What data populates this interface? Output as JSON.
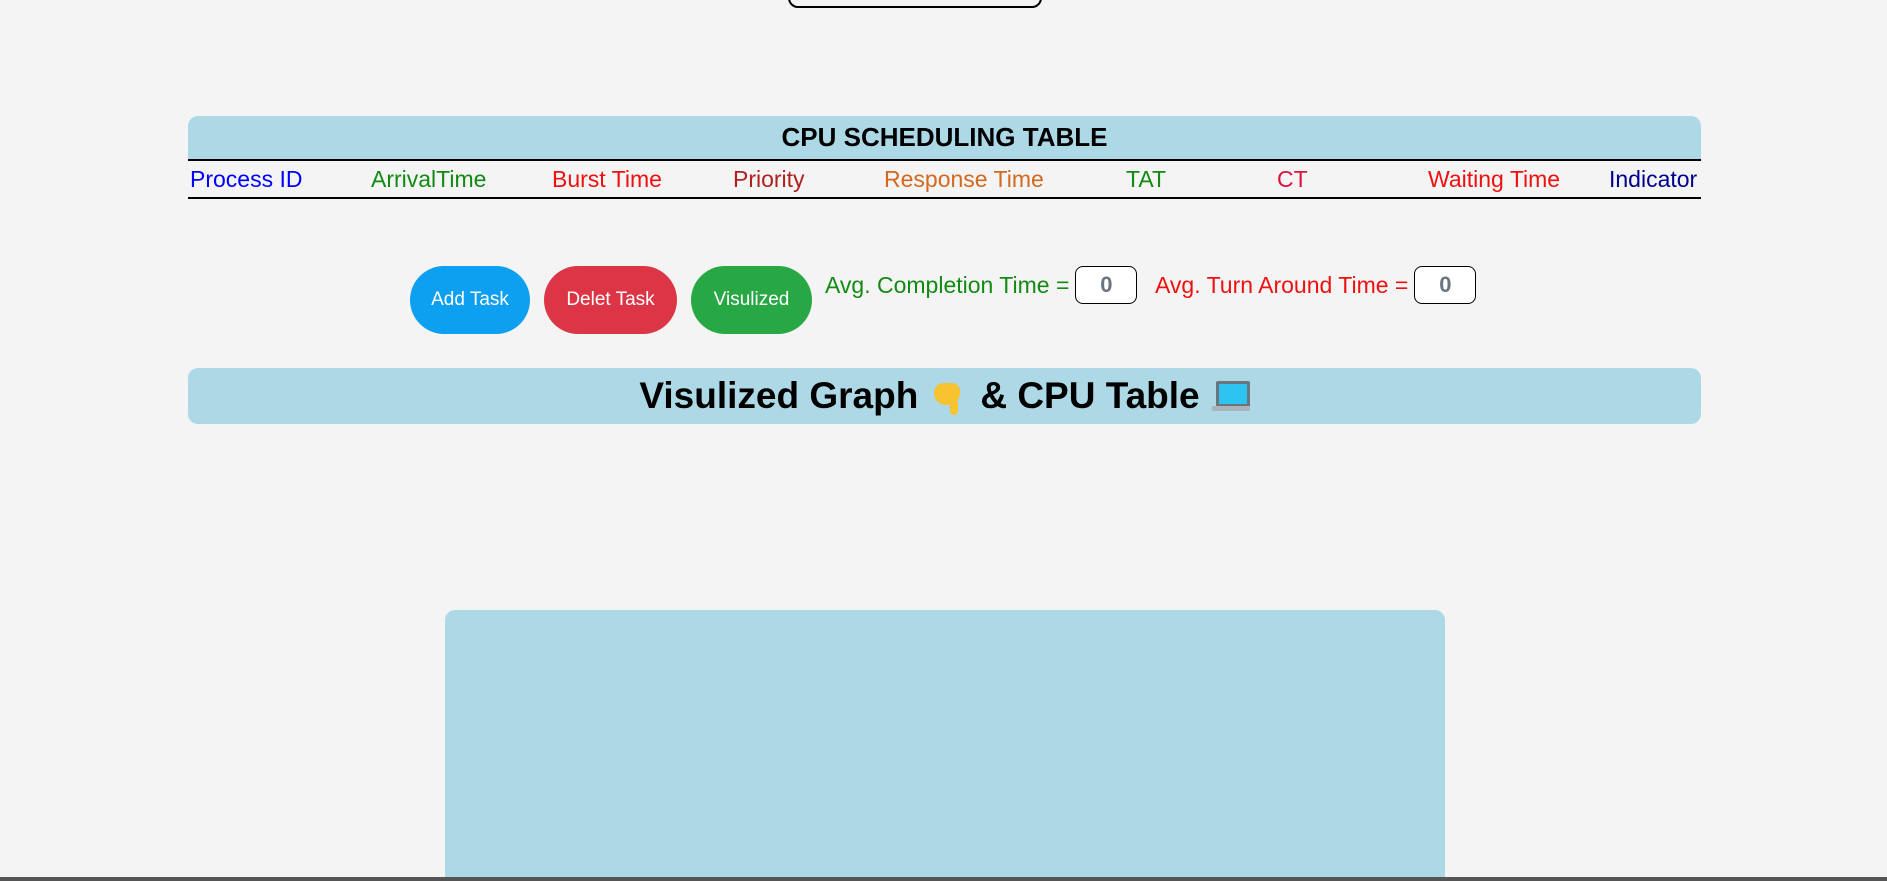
{
  "table": {
    "title": "CPU SCHEDULING TABLE",
    "columns": [
      {
        "label": "Process ID",
        "color": "#0000ff"
      },
      {
        "label": "ArrivalTime",
        "color": "#138a13"
      },
      {
        "label": "Burst Time",
        "color": "#ee1111"
      },
      {
        "label": "Priority",
        "color": "#b02020"
      },
      {
        "label": "Response Time",
        "color": "#d2691e"
      },
      {
        "label": "TAT",
        "color": "#138a13"
      },
      {
        "label": "CT",
        "color": "#dc143c"
      },
      {
        "label": "Waiting Time",
        "color": "#ee1111"
      },
      {
        "label": "Indicator",
        "color": "#00008b"
      }
    ],
    "rows": []
  },
  "controls": {
    "add_label": "Add Task",
    "delete_label": "Delet Task",
    "visualize_label": "Visulized",
    "colors": {
      "add": "#0d9ff0",
      "delete": "#dc3545",
      "visualize": "#28a745"
    }
  },
  "averages": {
    "completion_label": "Avg. Completion Time =",
    "completion_value": "0",
    "turnaround_label": "Avg. Turn Around Time =",
    "turnaround_value": "0"
  },
  "banner": {
    "title_part1": "Visulized Graph",
    "title_part2": "& CPU Table",
    "icon_pointer": "backhand-index-pointing-down-icon",
    "icon_laptop": "laptop-icon"
  },
  "theme": {
    "panel_color": "#add8e6",
    "background": "#f4f4f4"
  }
}
